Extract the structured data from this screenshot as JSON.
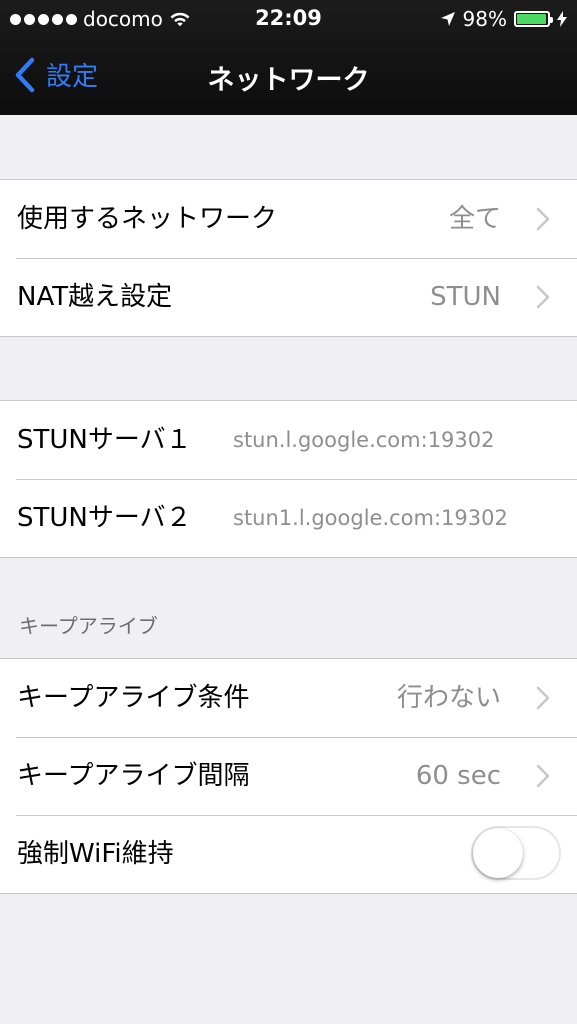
{
  "status_bar": {
    "carrier": "docomo",
    "time": "22:09",
    "battery_percent": "98%",
    "battery_level": 0.98,
    "signal_bars": 5
  },
  "nav": {
    "back_label": "設定",
    "title": "ネットワーク"
  },
  "network_group": {
    "rows": [
      {
        "label": "使用するネットワーク",
        "value": "全て"
      },
      {
        "label": "NAT越え設定",
        "value": "STUN"
      }
    ]
  },
  "stun_group": {
    "rows": [
      {
        "label": "STUNサーバ１",
        "value": "stun.l.google.com:19302"
      },
      {
        "label": "STUNサーバ２",
        "value": "stun1.l.google.com:19302"
      }
    ]
  },
  "keepalive": {
    "header": "キープアライブ",
    "rows": [
      {
        "label": "キープアライブ条件",
        "value": "行わない"
      },
      {
        "label": "キープアライブ間隔",
        "value": "60 sec"
      },
      {
        "label": "強制WiFi維持",
        "toggle_on": false
      }
    ]
  },
  "colors": {
    "accent": "#2f7cf6",
    "battery": "#4cd964",
    "background": "#efeff4"
  },
  "icons": [
    "wifi-icon",
    "location-arrow-icon",
    "battery-icon",
    "charging-bolt-icon",
    "back-chevron-icon",
    "chevron-right-icon"
  ]
}
